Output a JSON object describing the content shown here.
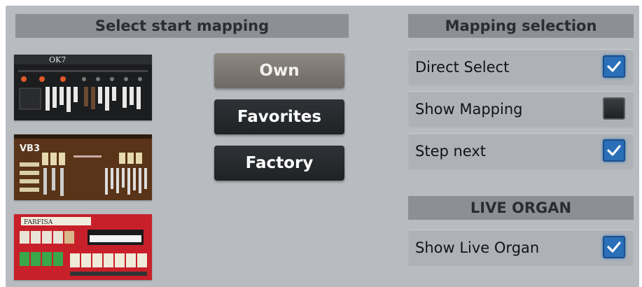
{
  "left": {
    "header": "Select start mapping",
    "thumbnails": [
      {
        "icon": "ok7-organ-thumbnail",
        "title": "OK7"
      },
      {
        "icon": "vb3-organ-thumbnail",
        "title": "VB3"
      },
      {
        "icon": "farfisa-organ-thumbnail",
        "title": "FARFISA"
      }
    ],
    "buttons": [
      {
        "label": "Own",
        "selected": true
      },
      {
        "label": "Favorites",
        "selected": false
      },
      {
        "label": "Factory",
        "selected": false
      }
    ]
  },
  "right": {
    "header": "Mapping selection",
    "options": [
      {
        "label": "Direct Select",
        "checked": true
      },
      {
        "label": "Show Mapping",
        "checked": false
      },
      {
        "label": "Step next",
        "checked": true
      }
    ],
    "live_header": "LIVE ORGAN",
    "live_option": {
      "label": "Show Live Organ",
      "checked": true
    }
  },
  "colors": {
    "panel_bg": "#b8bcc1",
    "header_bg": "#8c9096",
    "checkbox_on": "#2a6fb8",
    "button_dark": "#2f3236",
    "button_selected": "#8e8883"
  }
}
